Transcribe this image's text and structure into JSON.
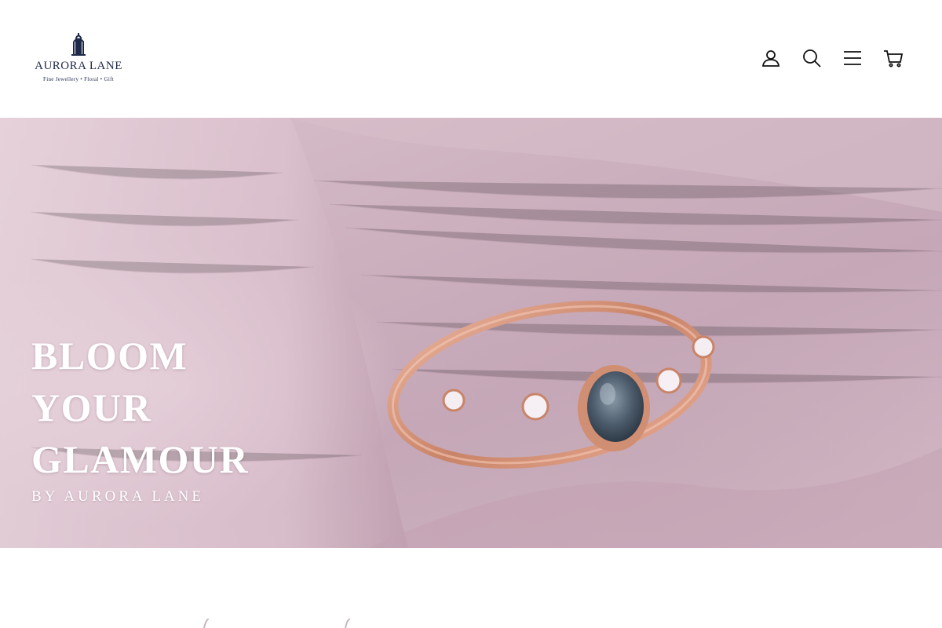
{
  "brand": {
    "name": "AURORA LANE",
    "tagline": "Fine Jewellery • Floral • Gift",
    "color": "#1f2a4a"
  },
  "nav": {
    "icons": [
      {
        "name": "account-icon"
      },
      {
        "name": "search-icon"
      },
      {
        "name": "menu-icon"
      },
      {
        "name": "cart-icon"
      }
    ]
  },
  "hero": {
    "title_lines": [
      "BLOOM",
      "YOUR",
      "GLAMOUR"
    ],
    "subtitle": "BY AURORA LANE",
    "image_subject": "rose gold ring with oval blue-grey stone on pink fabric"
  },
  "colors": {
    "text_on_hero": "#ffffff",
    "fabric_pink": "#d2b6c3",
    "rose_gold": "#d89a82"
  }
}
